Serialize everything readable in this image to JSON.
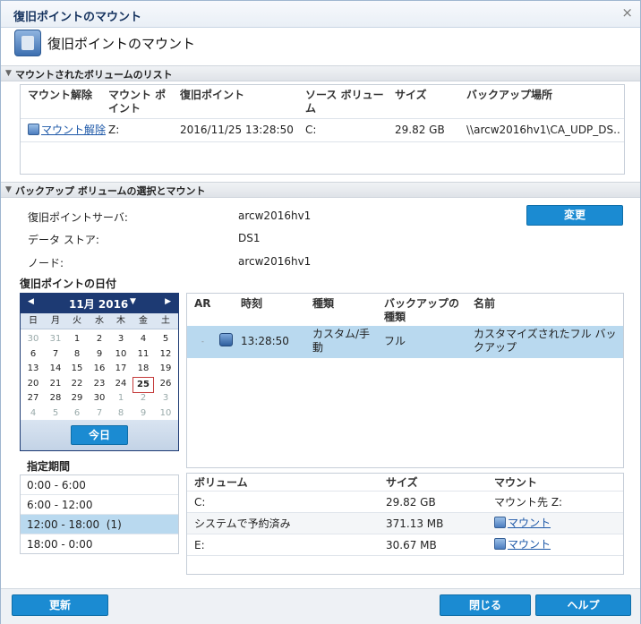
{
  "dialog": {
    "title": "復旧ポイントのマウント",
    "close_icon": "×",
    "header_title": "復旧ポイントのマウント"
  },
  "mounted_section": {
    "title": "マウントされたボリュームのリスト",
    "columns": [
      "マウント解除",
      "マウント ポイント",
      "復旧ポイント",
      "ソース ボリューム",
      "サイズ",
      "バックアップ場所"
    ],
    "rows": [
      {
        "unmount": "マウント解除",
        "mount_point": "Z:",
        "recovery_point": "2016/11/25 13:28:50",
        "source_volume": "C:",
        "size": "29.82 GB",
        "backup_location": "\\\\arcw2016hv1\\CA_UDP_DS..."
      }
    ]
  },
  "select_section": {
    "title": "バックアップ ボリュームの選択とマウント",
    "server_label": "復旧ポイントサーバ:",
    "server_value": "arcw2016hv1",
    "datastore_label": "データ ストア:",
    "datastore_value": "DS1",
    "node_label": "ノード:",
    "node_value": "arcw2016hv1",
    "change_button": "変更",
    "date_label": "復旧ポイントの日付"
  },
  "calendar": {
    "month": "11月 2016",
    "weekdays": [
      "日",
      "月",
      "火",
      "水",
      "木",
      "金",
      "土"
    ],
    "weeks": [
      [
        "30",
        "31",
        "1",
        "2",
        "3",
        "4",
        "5"
      ],
      [
        "6",
        "7",
        "8",
        "9",
        "10",
        "11",
        "12"
      ],
      [
        "13",
        "14",
        "15",
        "16",
        "17",
        "18",
        "19"
      ],
      [
        "20",
        "21",
        "22",
        "23",
        "24",
        "25",
        "26"
      ],
      [
        "27",
        "28",
        "29",
        "30",
        "1",
        "2",
        "3"
      ],
      [
        "4",
        "5",
        "6",
        "7",
        "8",
        "9",
        "10"
      ]
    ],
    "selected_day": "25",
    "today_button": "今日"
  },
  "periods": {
    "title": "指定期間",
    "items": [
      {
        "label": "0:00 - 6:00",
        "count": ""
      },
      {
        "label": "6:00 - 12:00",
        "count": ""
      },
      {
        "label": "12:00 - 18:00",
        "count": "(1)"
      },
      {
        "label": "18:00 - 0:00",
        "count": ""
      }
    ]
  },
  "recovery_points": {
    "columns": [
      "AR",
      "時刻",
      "種類",
      "バックアップの種類",
      "名前"
    ],
    "rows": [
      {
        "ar": "-",
        "time": "13:28:50",
        "type": "カスタム/手動",
        "backup_type": "フル",
        "name": "カスタマイズされたフル バックアップ"
      }
    ]
  },
  "volumes": {
    "columns": [
      "ボリューム",
      "サイズ",
      "マウント"
    ],
    "rows": [
      {
        "volume": "C:",
        "size": "29.82 GB",
        "mount": "マウント先 Z:",
        "is_link": false
      },
      {
        "volume": "システムで予約済み",
        "size": "371.13 MB",
        "mount": "マウント",
        "is_link": true
      },
      {
        "volume": "E:",
        "size": "30.67 MB",
        "mount": "マウント",
        "is_link": true
      }
    ]
  },
  "footer": {
    "refresh": "更新",
    "close": "閉じる",
    "help": "ヘルプ"
  },
  "colors": {
    "accent": "#1b8bd2",
    "calendar_header": "#1d3a73",
    "selection": "#b9d9ef"
  }
}
